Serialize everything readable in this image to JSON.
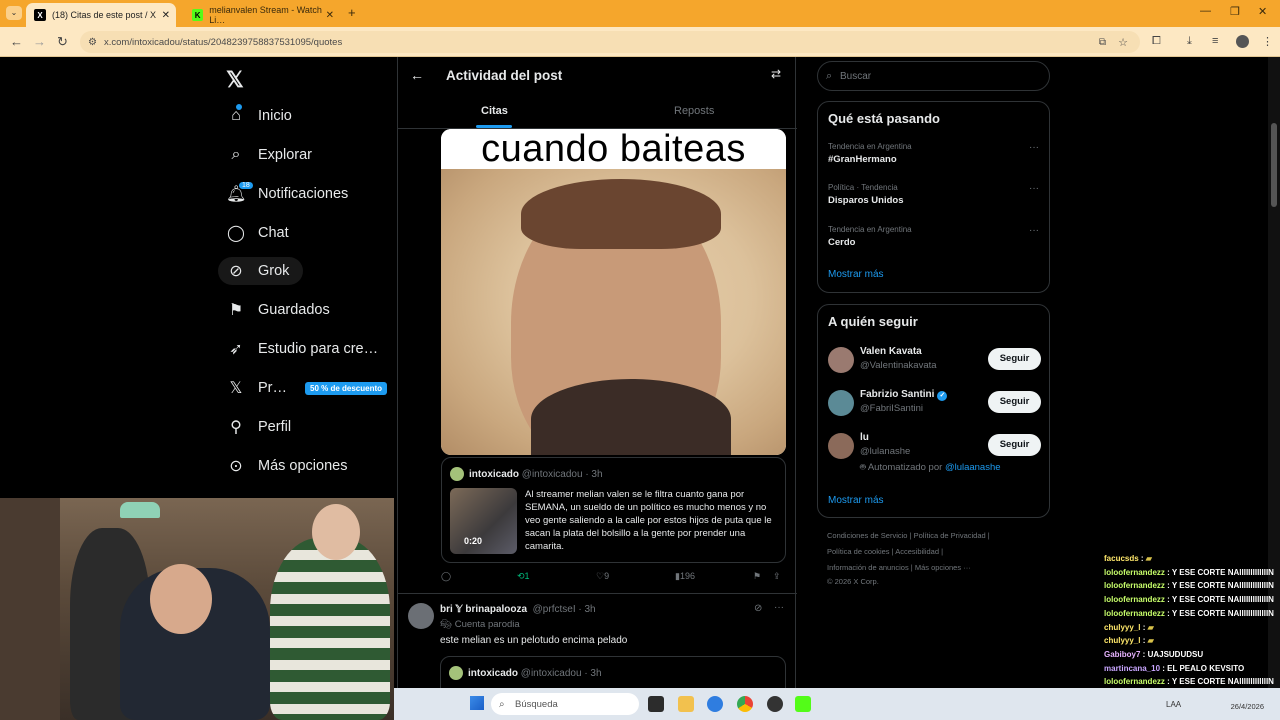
{
  "browser": {
    "tabs": [
      {
        "label": "(18) Citas de este post / X",
        "active": true
      },
      {
        "label": "melianvalen Stream - Watch Li…",
        "active": false
      }
    ],
    "url": "x.com/intoxicadou/status/2048239758837531095/quotes"
  },
  "sidebar": {
    "items": [
      {
        "label": "Inicio",
        "icon": "home-icon"
      },
      {
        "label": "Explorar",
        "icon": "search-icon"
      },
      {
        "label": "Notificaciones",
        "icon": "bell-icon",
        "badge": "18"
      },
      {
        "label": "Chat",
        "icon": "chat-icon"
      },
      {
        "label": "Grok",
        "icon": "grok-icon"
      },
      {
        "label": "Guardados",
        "icon": "bookmark-icon"
      },
      {
        "label": "Estudio para cre…",
        "icon": "rocket-icon"
      },
      {
        "label": "Pr…",
        "icon": "x-logo-icon",
        "promo": "50 % de descuento"
      },
      {
        "label": "Perfil",
        "icon": "person-icon"
      },
      {
        "label": "Más opciones",
        "icon": "more-circle-icon"
      }
    ]
  },
  "main": {
    "title": "Actividad del post",
    "tabs": [
      "Citas",
      "Reposts"
    ],
    "meme_caption": "cuando baiteas",
    "quote": {
      "name": "intoxicado",
      "handle": "@intoxicadou · 3h",
      "duration": "0:20",
      "text": "Al streamer melian valen se le filtra cuanto gana por SEMANA, un sueldo de un político es mucho menos y no veo gente saliendo a la calle por estos hijos de puta que le sacan la plata del bolsillo a la gente por prender una camarita."
    },
    "actions": {
      "reposts": "1",
      "likes": "9",
      "views": "196"
    },
    "post2": {
      "name": "bri 𝕐 brinapalooza",
      "handle": "@prfctseI · 3h",
      "parody": "Cuenta parodia",
      "text": "este melian es un pelotudo encima pelado",
      "quote_name": "intoxicado",
      "quote_handle": "@intoxicadou · 3h"
    }
  },
  "right": {
    "search_placeholder": "Buscar",
    "trends_title": "Qué está pasando",
    "trends": [
      {
        "context": "Tendencia en Argentina",
        "name": "#GranHermano"
      },
      {
        "context": "Política · Tendencia",
        "name": "Disparos Unidos"
      },
      {
        "context": "Tendencia en Argentina",
        "name": "Cerdo"
      }
    ],
    "show_more": "Mostrar más",
    "follow_title": "A quién seguir",
    "follow": [
      {
        "name": "Valen Kavata",
        "handle": "@Valentinakavata",
        "button": "Seguir"
      },
      {
        "name": "Fabrizio Santini",
        "handle": "@FabriISantini",
        "button": "Seguir"
      },
      {
        "name": "lu",
        "handle": "@lulanashe",
        "auto": "Automatizado por",
        "auto_by": "@lulaanashe",
        "button": "Seguir"
      }
    ],
    "footer": [
      "Condiciones de Servicio  |  Política de Privacidad  |",
      "Política de cookies  |  Accesibilidad  |",
      "Información de anuncios  |  Más opciones ···",
      "© 2026 X Corp."
    ]
  },
  "chat": [
    {
      "user": "facucsds",
      "msg": "",
      "color": "#ffe86b"
    },
    {
      "user": "loloofernandezz",
      "msg": "Y ESE CORTE NAIIIIIIIIIIIIIN",
      "color": "#c8ff6b"
    },
    {
      "user": "loloofernandezz",
      "msg": "Y ESE CORTE NAIIIIIIIIIIIIIN",
      "color": "#c8ff6b"
    },
    {
      "user": "loloofernandezz",
      "msg": "Y ESE CORTE NAIIIIIIIIIIIIIN",
      "color": "#c8ff6b"
    },
    {
      "user": "loloofernandezz",
      "msg": "Y ESE CORTE NAIIIIIIIIIIIIIN",
      "color": "#c8ff6b"
    },
    {
      "user": "chulyyy_l",
      "msg": "",
      "color": "#ffe86b"
    },
    {
      "user": "chulyyy_l",
      "msg": "",
      "color": "#ffe86b"
    },
    {
      "user": "Gabiboy7",
      "msg": "UAJSUDUDSU",
      "color": "#e7b3ff"
    },
    {
      "user": "martincana_10",
      "msg": "EL PEALO KEVSITO",
      "color": "#c9a6ff"
    },
    {
      "user": "loloofernandezz",
      "msg": "Y ESE CORTE NAIIIIIIIIIIIIIN",
      "color": "#c8ff6b"
    },
    {
      "user": "loloofernandezz",
      "msg": "Y ESE CORTE NAIIIIIIIIIIIIIN",
      "color": "#c8ff6b"
    }
  ],
  "taskbar": {
    "search": "Búsqueda",
    "lang": "LAA",
    "date": "26/4/2026"
  },
  "colors": {
    "accent": "#1d9bf0",
    "tabbar": "#f5a62c"
  }
}
